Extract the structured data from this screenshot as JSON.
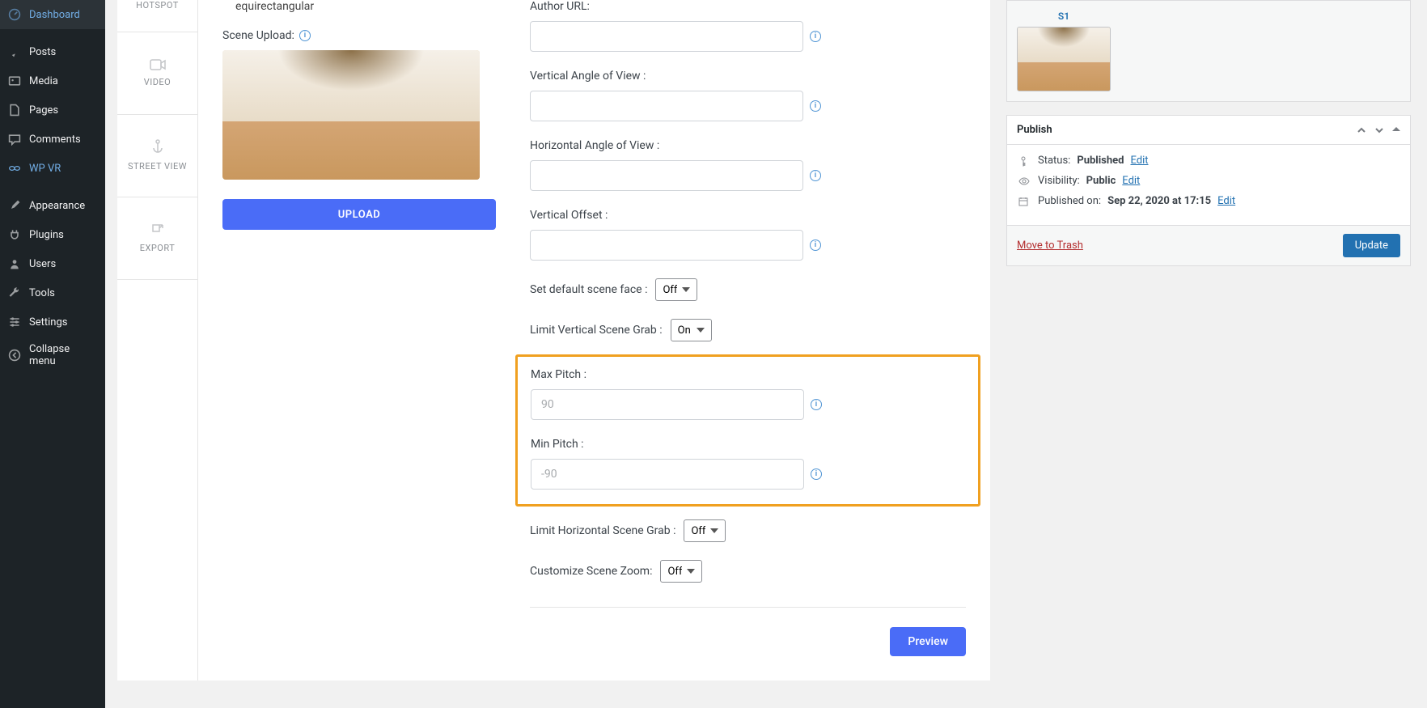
{
  "sidebar": {
    "items": [
      {
        "label": "Dashboard"
      },
      {
        "label": "Posts"
      },
      {
        "label": "Media"
      },
      {
        "label": "Pages"
      },
      {
        "label": "Comments"
      },
      {
        "label": "WP VR"
      },
      {
        "label": "Appearance"
      },
      {
        "label": "Plugins"
      },
      {
        "label": "Users"
      },
      {
        "label": "Tools"
      },
      {
        "label": "Settings"
      },
      {
        "label": "Collapse menu"
      }
    ]
  },
  "tabs": {
    "hotspot": "HOTSPOT",
    "video": "VIDEO",
    "street": "STREET VIEW",
    "export": "EXPORT"
  },
  "form": {
    "type_value": "equirectangular",
    "scene_upload_label": "Scene Upload:",
    "upload_btn": "UPLOAD",
    "author_url_label": "Author URL:",
    "author_url_value": "",
    "vav_label": "Vertical Angle of View :",
    "vav_value": "",
    "hav_label": "Horizontal Angle of View :",
    "hav_value": "",
    "voffset_label": "Vertical Offset :",
    "voffset_value": "",
    "default_face_label": "Set default scene face :",
    "default_face_value": "Off",
    "limit_v_label": "Limit Vertical Scene Grab :",
    "limit_v_value": "On",
    "max_pitch_label": "Max Pitch :",
    "max_pitch_placeholder": "90",
    "min_pitch_label": "Min Pitch :",
    "min_pitch_placeholder": "-90",
    "limit_h_label": "Limit Horizontal Scene Grab :",
    "limit_h_value": "Off",
    "zoom_label": "Customize Scene Zoom:",
    "zoom_value": "Off",
    "preview_btn": "Preview"
  },
  "scene_panel": {
    "title": "S1"
  },
  "publish": {
    "heading": "Publish",
    "status_label": "Status: ",
    "status_value": "Published",
    "visibility_label": "Visibility: ",
    "visibility_value": "Public",
    "published_label": "Published on: ",
    "published_value": "Sep 22, 2020 at 17:15",
    "edit": "Edit",
    "trash": "Move to Trash",
    "update": "Update"
  }
}
